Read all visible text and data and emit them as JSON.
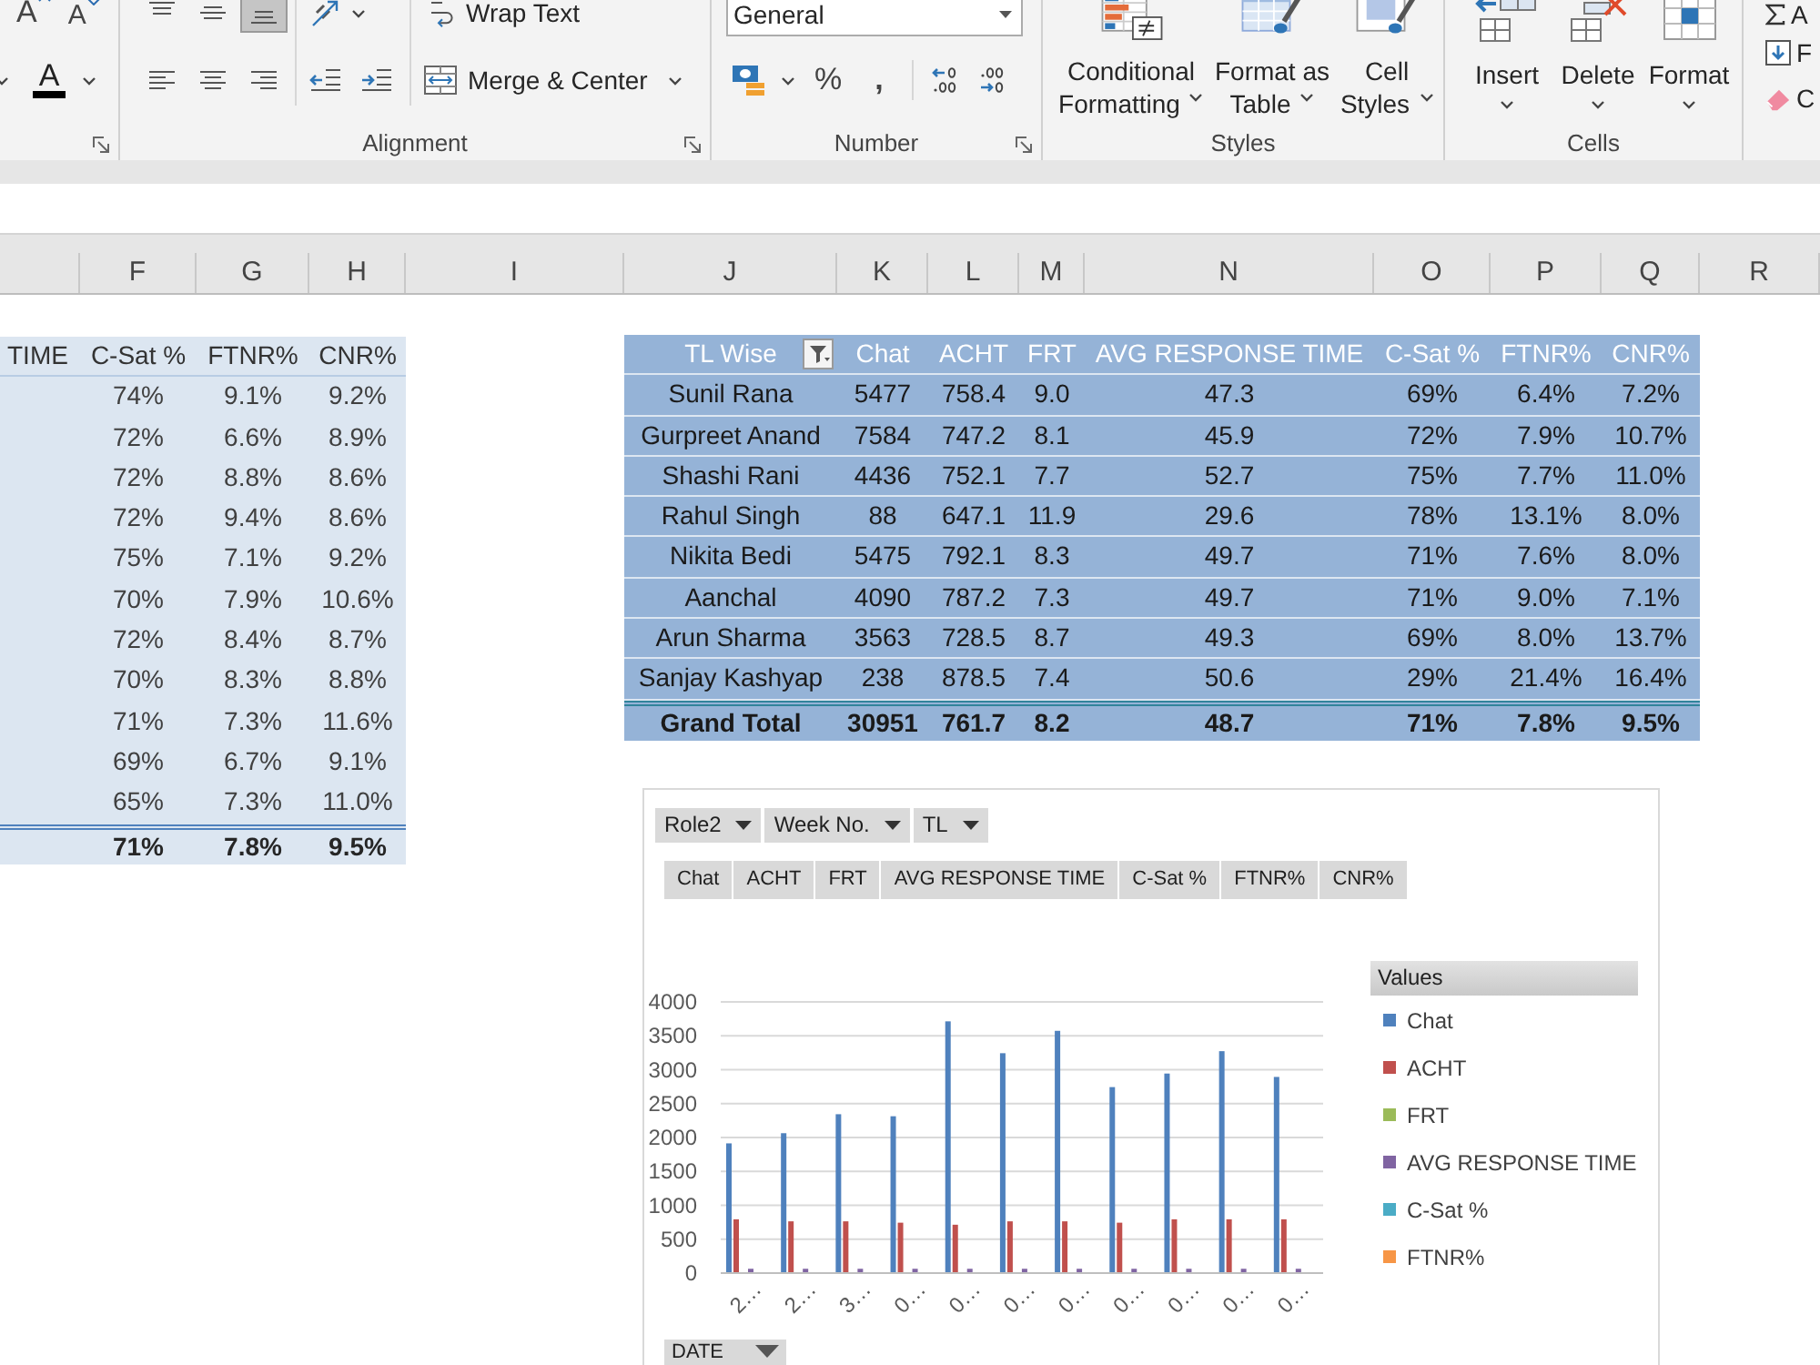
{
  "ribbon": {
    "font": {
      "grow_font": "A",
      "shrink_font": "A",
      "font_color": "A"
    },
    "alignment": {
      "label": "Alignment",
      "vertical_align": [
        {
          "selected": false
        },
        {
          "selected": false
        },
        {
          "selected": true
        }
      ],
      "horizontal_align": [
        {
          "selected": false
        },
        {
          "selected": false
        },
        {
          "selected": false
        }
      ],
      "wrap_text": "Wrap Text",
      "merge_center": "Merge & Center"
    },
    "number": {
      "label": "Number",
      "format": "General",
      "percent": "%",
      "comma": ","
    },
    "styles": {
      "label": "Styles",
      "buttons": [
        {
          "lines": [
            "Conditional",
            "Formatting"
          ]
        },
        {
          "lines": [
            "Format as",
            "Table"
          ]
        },
        {
          "lines": [
            "Cell",
            "Styles"
          ]
        }
      ]
    },
    "cells": {
      "label": "Cells",
      "buttons": [
        "Insert",
        "Delete",
        "Format"
      ]
    },
    "editing": {
      "autosum": "A",
      "fill": "F",
      "clear": "C"
    }
  },
  "sheet": {
    "columns": [
      "F",
      "G",
      "H",
      "I",
      "J",
      "K",
      "L",
      "M",
      "N",
      "O",
      "P",
      "Q",
      "R"
    ],
    "left_table": {
      "header": [
        "TIME",
        "C-Sat %",
        "FTNR%",
        "CNR%"
      ],
      "rows": [
        [
          "74%",
          "9.1%",
          "9.2%"
        ],
        [
          "72%",
          "6.6%",
          "8.9%"
        ],
        [
          "72%",
          "8.8%",
          "8.6%"
        ],
        [
          "72%",
          "9.4%",
          "8.6%"
        ],
        [
          "75%",
          "7.1%",
          "9.2%"
        ],
        [
          "70%",
          "7.9%",
          "10.6%"
        ],
        [
          "72%",
          "8.4%",
          "8.7%"
        ],
        [
          "70%",
          "8.3%",
          "8.8%"
        ],
        [
          "71%",
          "7.3%",
          "11.6%"
        ],
        [
          "69%",
          "6.7%",
          "9.1%"
        ],
        [
          "65%",
          "7.3%",
          "11.0%"
        ]
      ],
      "total": [
        "71%",
        "7.8%",
        "9.5%"
      ]
    },
    "right_table": {
      "header": [
        "TL Wise",
        "Chat",
        "ACHT",
        "FRT",
        "AVG RESPONSE TIME",
        "C-Sat %",
        "FTNR%",
        "CNR%"
      ],
      "rows": [
        [
          "Sunil Rana",
          "5477",
          "758.4",
          "9.0",
          "47.3",
          "69%",
          "6.4%",
          "7.2%"
        ],
        [
          "Gurpreet Anand",
          "7584",
          "747.2",
          "8.1",
          "45.9",
          "72%",
          "7.9%",
          "10.7%"
        ],
        [
          "Shashi Rani",
          "4436",
          "752.1",
          "7.7",
          "52.7",
          "75%",
          "7.7%",
          "11.0%"
        ],
        [
          "Rahul Singh",
          "88",
          "647.1",
          "11.9",
          "29.6",
          "78%",
          "13.1%",
          "8.0%"
        ],
        [
          "Nikita Bedi",
          "5475",
          "792.1",
          "8.3",
          "49.7",
          "71%",
          "7.6%",
          "8.0%"
        ],
        [
          "Aanchal",
          "4090",
          "787.2",
          "7.3",
          "49.7",
          "71%",
          "9.0%",
          "7.1%"
        ],
        [
          "Arun Sharma",
          "3563",
          "728.5",
          "8.7",
          "49.3",
          "69%",
          "8.0%",
          "13.7%"
        ],
        [
          "Sanjay Kashyap",
          "238",
          "878.5",
          "7.4",
          "50.6",
          "29%",
          "21.4%",
          "16.4%"
        ]
      ],
      "total": [
        "Grand Total",
        "30951",
        "761.7",
        "8.2",
        "48.7",
        "71%",
        "7.8%",
        "9.5%"
      ]
    },
    "pivot_chart": {
      "filter_fields": [
        "Role2",
        "Week No.",
        "TL"
      ],
      "value_fields": [
        "Chat",
        "ACHT",
        "FRT",
        "AVG RESPONSE TIME",
        "C-Sat %",
        "FTNR%",
        "CNR%"
      ],
      "axis_field": "DATE",
      "chart_data": [
        {
          "type": "bar",
          "categories": [
            "2…",
            "2…",
            "3…",
            "0…",
            "0…",
            "0…",
            "0…",
            "0…",
            "0…",
            "0…",
            "0…"
          ],
          "ylim": [
            0,
            4000
          ],
          "yticks": [
            0,
            500,
            1000,
            1500,
            2000,
            2500,
            3000,
            3500,
            4000
          ],
          "grid": true,
          "legend": "right",
          "legend_title": "Values",
          "series": [
            {
              "name": "Chat",
              "color": "#4f81bd",
              "values": [
                1900,
                2050,
                2330,
                2300,
                3700,
                3230,
                3560,
                2730,
                2930,
                3260,
                2880
              ]
            },
            {
              "name": "ACHT",
              "color": "#c0504d",
              "values": [
                780,
                750,
                750,
                730,
                700,
                750,
                750,
                730,
                780,
                780,
                780
              ]
            },
            {
              "name": "FRT",
              "color": "#9bbb59",
              "values": [
                0,
                0,
                0,
                0,
                0,
                0,
                0,
                0,
                0,
                0,
                0
              ]
            },
            {
              "name": "AVG RESPONSE TIME",
              "color": "#8064a2",
              "values": [
                50,
                50,
                50,
                50,
                50,
                50,
                50,
                50,
                50,
                50,
                50
              ]
            },
            {
              "name": "C-Sat %",
              "color": "#4bacc6",
              "values": [
                0,
                0,
                0,
                0,
                0,
                0,
                0,
                0,
                0,
                0,
                0
              ]
            },
            {
              "name": "FTNR%",
              "color": "#f79646",
              "values": [
                0,
                0,
                0,
                0,
                0,
                0,
                0,
                0,
                0,
                0,
                0
              ]
            }
          ]
        }
      ]
    }
  }
}
